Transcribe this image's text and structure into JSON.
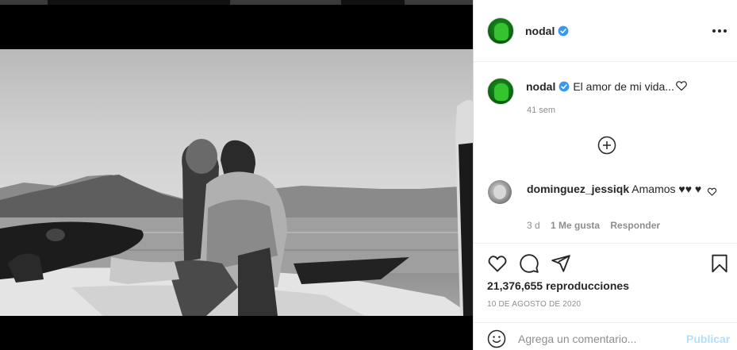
{
  "post": {
    "username": "nodal",
    "more_icon": "more-horizontal-icon"
  },
  "caption": {
    "username": "nodal",
    "text": "El amor de mi vida...",
    "time_ago": "41 sem"
  },
  "comment": {
    "username": "dominguez_jessiqk",
    "text": "Amamos ♥♥ ♥",
    "time": "3 d",
    "likes": "1 Me gusta",
    "reply": "Responder"
  },
  "actions": {
    "views": "21,376,655 reproducciones",
    "date": "10 DE AGOSTO DE 2020"
  },
  "comment_box": {
    "placeholder": "Agrega un comentario...",
    "publish": "Publicar"
  },
  "colors": {
    "verified": "#3897f0",
    "publish_disabled": "#b2dffc",
    "text_secondary": "#8e8e8e"
  }
}
